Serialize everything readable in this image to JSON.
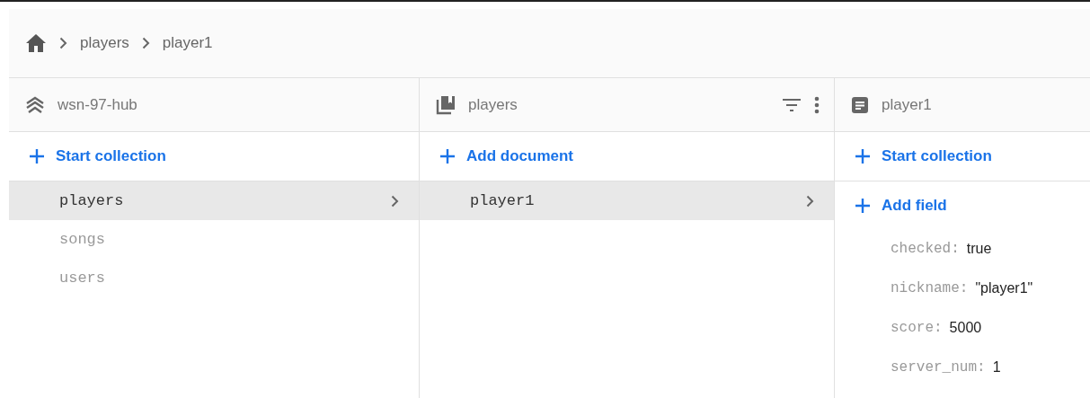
{
  "breadcrumb": [
    "players",
    "player1"
  ],
  "columns": [
    {
      "kind": "root",
      "title": "wsn-97-hub",
      "actions": [
        "Start collection"
      ],
      "items": [
        {
          "label": "players",
          "selected": true
        },
        {
          "label": "songs",
          "selected": false
        },
        {
          "label": "users",
          "selected": false
        }
      ]
    },
    {
      "kind": "collection",
      "title": "players",
      "actions": [
        "Add document"
      ],
      "items": [
        {
          "label": "player1",
          "selected": true
        }
      ]
    },
    {
      "kind": "document",
      "title": "player1",
      "actions": [
        "Start collection",
        "Add field"
      ],
      "fields": [
        {
          "key": "checked:",
          "value": "true"
        },
        {
          "key": "nickname:",
          "value": "\"player1\""
        },
        {
          "key": "score:",
          "value": "5000"
        },
        {
          "key": "server_num:",
          "value": "1"
        }
      ]
    }
  ]
}
